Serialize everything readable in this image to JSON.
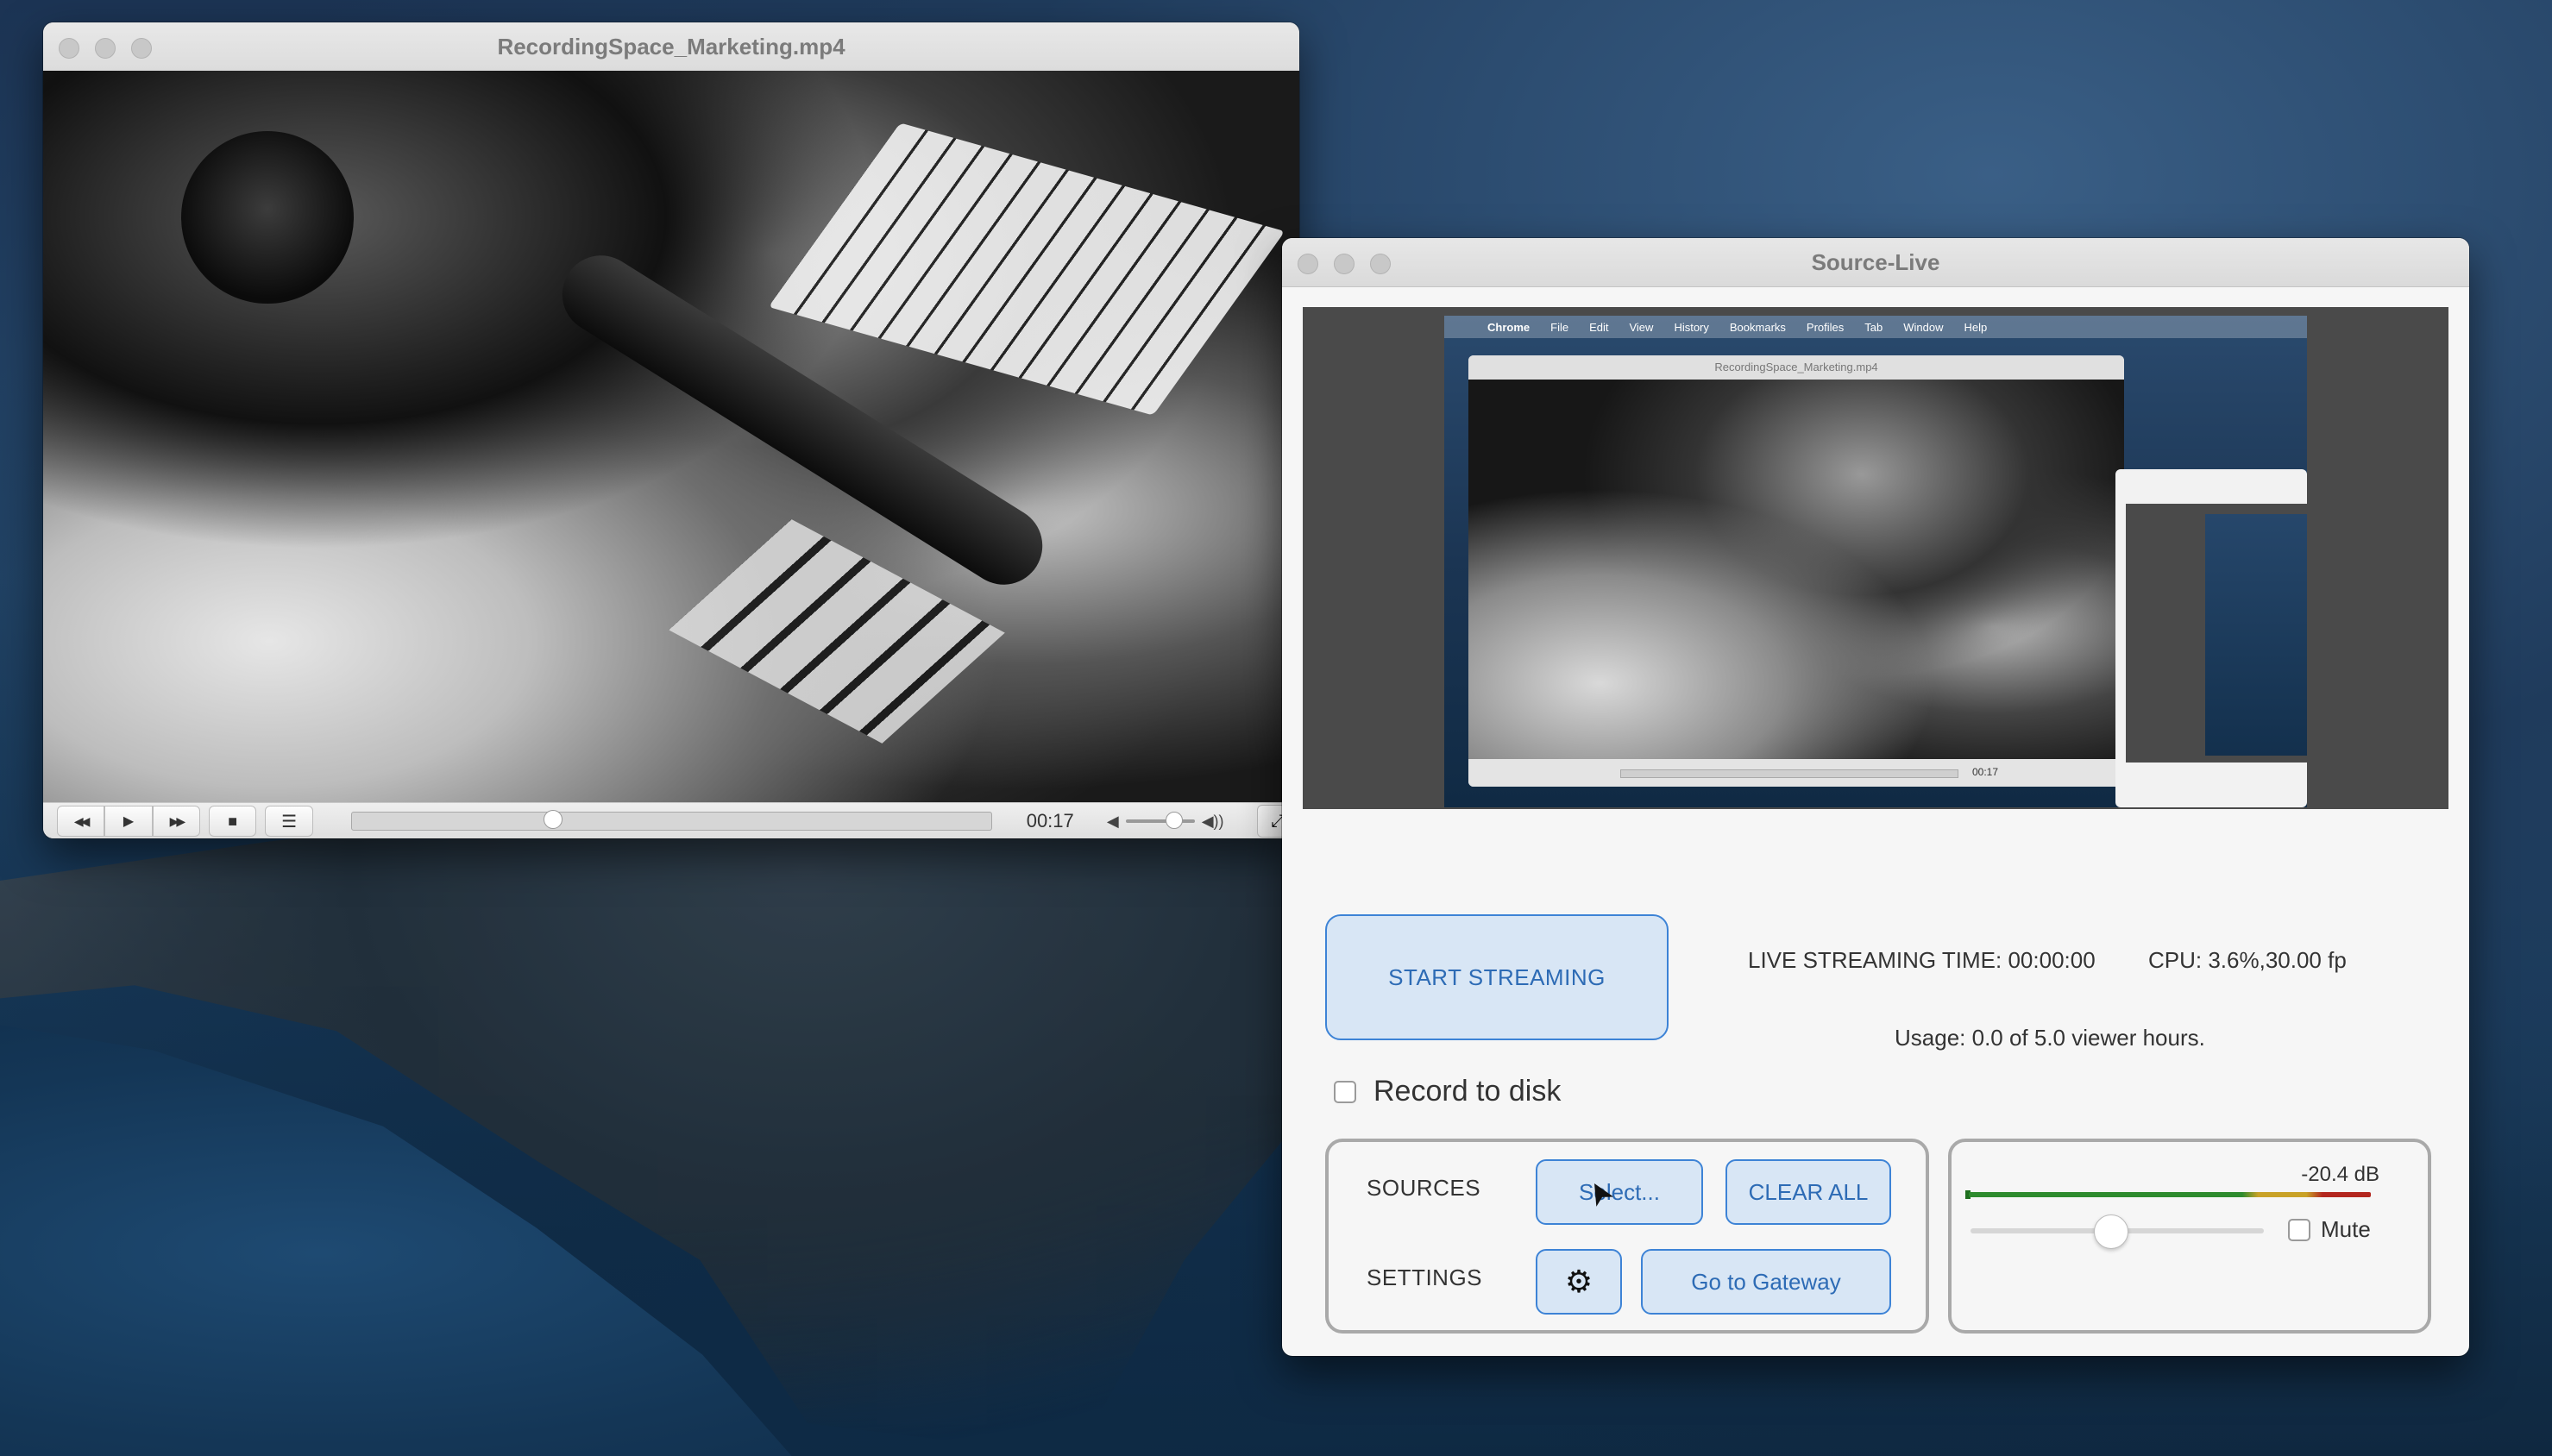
{
  "desktop": {
    "description_colors": {
      "sky": "#1f3b5c",
      "sea": "#143656"
    }
  },
  "vlc": {
    "title": "RecordingSpace_Marketing.mp4",
    "controls": {
      "rewind_icon": "◀◀",
      "play_icon": "▶",
      "forward_icon": "▶▶",
      "stop_icon": "■",
      "playlist_icon": "☰",
      "time": "00:17",
      "progress_fraction": 0.315,
      "volume_fraction": 0.7,
      "mute_icon": "◀",
      "vol_max_icon": "◀))",
      "fullscreen_icon": "⤢"
    }
  },
  "preview": {
    "menubar": [
      "Chrome",
      "File",
      "Edit",
      "View",
      "History",
      "Bookmarks",
      "Profiles",
      "Tab",
      "Window",
      "Help"
    ],
    "vlc_title": "RecordingSpace_Marketing.mp4",
    "vlc_time": "00:17"
  },
  "source_live": {
    "title": "Source-Live",
    "start_streaming": "START STREAMING",
    "live_time": "LIVE STREAMING TIME: 00:00:00",
    "cpu": "CPU: 3.6%,30.00 fp",
    "usage": "Usage: 0.0 of 5.0 viewer hours.",
    "record_label": "Record to disk",
    "record_checked": false,
    "sources_label": "SOURCES",
    "select_button": "Select...",
    "clear_all_button": "CLEAR ALL",
    "settings_label": "SETTINGS",
    "gear_icon": "⚙",
    "gateway_button": "Go to Gateway",
    "audio": {
      "level_db": "-20.4 dB",
      "volume_fraction": 0.48,
      "mute_label": "Mute",
      "mute_checked": false,
      "meter_colors": {
        "green": "#2e8b2e",
        "yellow": "#c9a227",
        "red": "#b3261e"
      }
    },
    "accent": "#3d83d6",
    "button_fill": "#d8e6f5"
  }
}
